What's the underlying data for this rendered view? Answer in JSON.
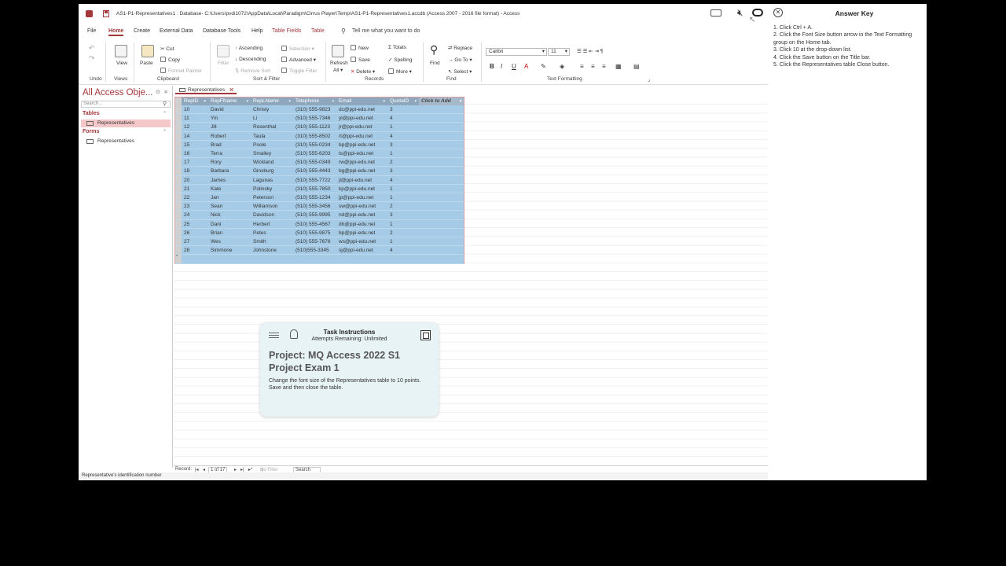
{
  "titlebar": {
    "title": "AS1-P1-Representatives1 : Database- C:\\Users\\pvdi1072\\AppData\\Local\\Paradigm\\Cirrus Player\\Temp\\AS1-P1-Representatives1.accdb (Access 2007 - 2016 file format)  -  Access"
  },
  "menu": {
    "tabs": [
      "File",
      "Home",
      "Create",
      "External Data",
      "Database Tools",
      "Help",
      "Table Fields",
      "Table"
    ],
    "tell_me": "Tell me what you want to do"
  },
  "ribbon": {
    "undo_group": "Undo",
    "views_group": "Views",
    "view": "View",
    "paste": "Paste",
    "cut": "Cut",
    "copy": "Copy",
    "format_painter": "Format Painter",
    "clipboard_group": "Clipboard",
    "filter": "Filter",
    "ascending": "Ascending",
    "descending": "Descending",
    "remove_sort": "Remove Sort",
    "selection": "Selection",
    "advanced": "Advanced",
    "toggle_filter": "Toggle Filter",
    "sort_filter_group": "Sort & Filter",
    "refresh": "Refresh",
    "refresh_all": "All",
    "new": "New",
    "save": "Save",
    "delete": "Delete",
    "totals": "Totals",
    "spelling": "Spelling",
    "more": "More",
    "records_group": "Records",
    "find": "Find",
    "replace": "Replace",
    "goto": "Go To",
    "select": "Select",
    "find_group": "Find",
    "font": "Calibri",
    "font_size": "11",
    "text_formatting_group": "Text Formatting"
  },
  "nav": {
    "title": "All Access Obje...",
    "search_placeholder": "Search...",
    "tables_header": "Tables",
    "forms_header": "Forms",
    "table_item": "Representatives",
    "form_item": "Representatives"
  },
  "document": {
    "tab_label": "Representatives"
  },
  "datasheet": {
    "columns": [
      "RepID",
      "RepFName",
      "RepLName",
      "Telephone",
      "Email",
      "QuotaID",
      "Click to Add"
    ],
    "rows": [
      [
        "10",
        "David",
        "Christy",
        "(310) 555-9823",
        "dc@ppi-edu.net",
        "3"
      ],
      [
        "11",
        "Yin",
        "Li",
        "(510) 555-7346",
        "yl@ppi-edu.net",
        "4"
      ],
      [
        "12",
        "Jill",
        "Rosenthal",
        "(310) 555-1123",
        "jr@ppi-edu.net",
        "1"
      ],
      [
        "14",
        "Robert",
        "Taula",
        "(310) 555-8502",
        "rt@ppi-edu.net",
        "4"
      ],
      [
        "15",
        "Brad",
        "Poole",
        "(310) 555-0234",
        "bp@ppi-edu.net",
        "3"
      ],
      [
        "16",
        "Terra",
        "Smalley",
        "(510) 555-6203",
        "ts@ppi-edu.net",
        "1"
      ],
      [
        "17",
        "Rory",
        "Wickland",
        "(510) 555-0349",
        "rw@ppi-edu.net",
        "2"
      ],
      [
        "18",
        "Barbara",
        "Ginsburg",
        "(510) 555-4443",
        "bg@ppi-edu.net",
        "3"
      ],
      [
        "20",
        "James",
        "Lagunas",
        "(510) 555-7722",
        "jl@ppi-edu.net",
        "4"
      ],
      [
        "21",
        "Kate",
        "Polinsky",
        "(310) 555-7850",
        "kp@ppi-edu.net",
        "1"
      ],
      [
        "22",
        "Jan",
        "Peterson",
        "(510) 555-1234",
        "jp@ppi-edu.net",
        "1"
      ],
      [
        "23",
        "Sean",
        "Williamson",
        "(510) 555-3456",
        "sw@ppi-edu.net",
        "2"
      ],
      [
        "24",
        "Nick",
        "Davidson",
        "(510) 555-9995",
        "nd@ppi-edu.net",
        "3"
      ],
      [
        "25",
        "Dani",
        "Herbert",
        "(510) 555-4567",
        "dh@ppi-edu.net",
        "1"
      ],
      [
        "26",
        "Brian",
        "Petes",
        "(510) 555-9875",
        "bp@ppi-edu.net",
        "2"
      ],
      [
        "27",
        "Wes",
        "Smith",
        "(510) 555-7676",
        "ws@ppi-edu.net",
        "1"
      ],
      [
        "28",
        "Simmone",
        "Johnstone",
        "(510)555-3345",
        "sj@ppi-edu.net",
        "4"
      ]
    ]
  },
  "record_nav": {
    "label": "Record:",
    "position": "1 of 17",
    "filter": "No Filter",
    "search": "Search"
  },
  "status": {
    "text": "Representative's identification number"
  },
  "task": {
    "title": "Task Instructions",
    "attempts": "Attempts Remaining: Unlimited",
    "project": "Project: MQ Access 2022 S1 Project Exam 1",
    "description": "Change the font size of the Representatives table to 10 points. Save and then close the table."
  },
  "answer_key": {
    "title": "Answer Key",
    "steps": [
      "1. Click Ctrl + A.",
      "2. Click the Font Size button arrow in the Text Formatting group on the Home tab.",
      "3. Click 10 at the drop-down list.",
      "4. Click the Save button on the Title bar.",
      "5. Click the Representatives table Close button."
    ]
  },
  "colors": {
    "access_accent": "#a4373a",
    "selection_blue": "#a6cbe6",
    "header_gray_blue": "#8fa7bd"
  }
}
